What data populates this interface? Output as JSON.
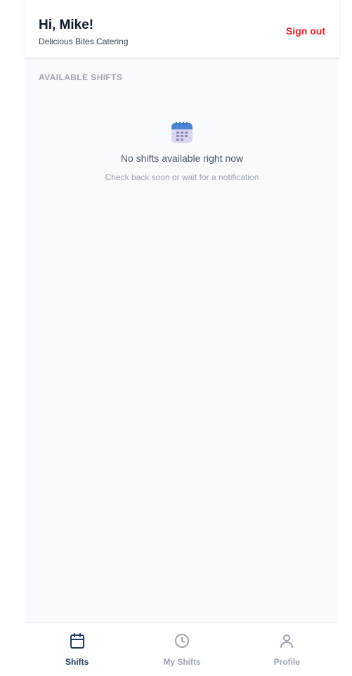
{
  "header": {
    "greeting": "Hi, Mike!",
    "company": "Delicious Bites Catering",
    "signout_label": "Sign out"
  },
  "section": {
    "title": "AVAILABLE SHIFTS"
  },
  "empty_state": {
    "icon": "calendar-icon",
    "title": "No shifts available right now",
    "subtitle": "Check back soon or wait for a notification"
  },
  "tabs": [
    {
      "label": "Shifts",
      "icon": "calendar-icon",
      "active": true
    },
    {
      "label": "My Shifts",
      "icon": "clock-icon",
      "active": false
    },
    {
      "label": "Profile",
      "icon": "user-icon",
      "active": false
    }
  ],
  "colors": {
    "accent": "#1e3a5f",
    "danger": "#dc2626",
    "muted": "#9ca3af",
    "background": "#f8fafc"
  }
}
